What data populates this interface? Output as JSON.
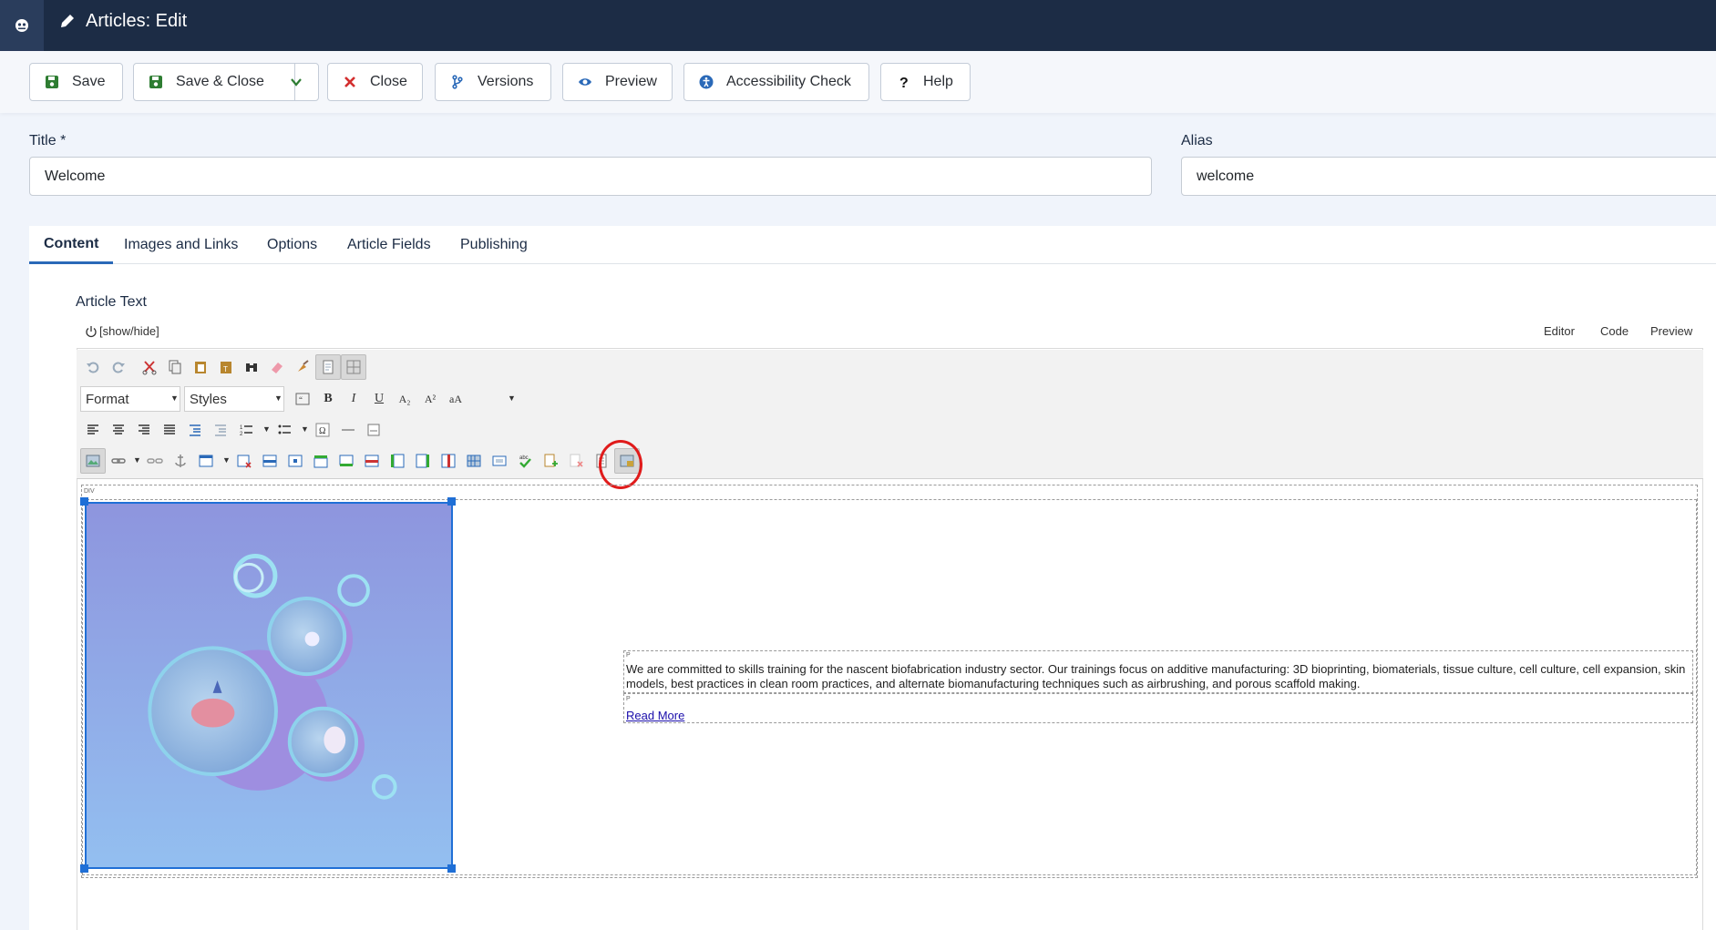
{
  "header": {
    "title": "Articles: Edit",
    "brand_icon": "joomla-logo",
    "title_icon": "pencil-icon"
  },
  "toolbar": {
    "save": "Save",
    "save_close": "Save & Close",
    "close": "Close",
    "versions": "Versions",
    "preview": "Preview",
    "accessibility": "Accessibility Check",
    "help": "Help"
  },
  "form": {
    "title_label": "Title *",
    "title_value": "Welcome",
    "alias_label": "Alias",
    "alias_value": "welcome"
  },
  "tabs": {
    "content": "Content",
    "images_links": "Images and Links",
    "options": "Options",
    "article_fields": "Article Fields",
    "publishing": "Publishing"
  },
  "editor": {
    "label": "Article Text",
    "show_hide": "[show/hide]",
    "modes": {
      "editor": "Editor",
      "code": "Code",
      "preview": "Preview"
    },
    "format_select": "Format",
    "styles_select": "Styles",
    "highlighted_button": "spellcheck-icon"
  },
  "document": {
    "div_tag": "DIV",
    "p_tag": "P",
    "paragraph": "We are committed to skills training for the nascent biofabrication industry sector. Our trainings focus on additive manufacturing: 3D bioprinting, biomaterials, tissue culture, cell culture, cell expansion, skin models, best practices in clean room practices, and alternate biomanufacturing techniques such as airbrushing, and porous scaffold making.",
    "read_more": "Read More"
  },
  "colors": {
    "header_bg": "#1c2c45",
    "accent": "#2a69b8",
    "save_green": "#2e7d32",
    "close_red": "#d32f2f",
    "highlight_ring": "#e01b1b"
  }
}
